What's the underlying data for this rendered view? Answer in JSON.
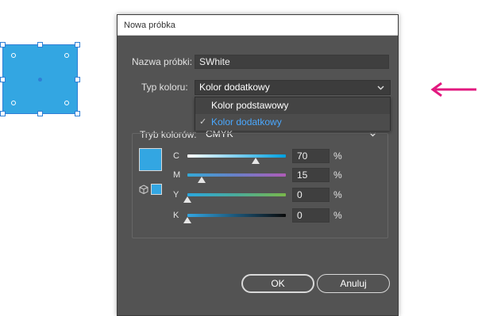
{
  "dialog": {
    "title": "Nowa próbka",
    "swatch_name_label": "Nazwa próbki:",
    "swatch_name_value": "SWhite",
    "color_type_label": "Typ koloru:",
    "color_type_value": "Kolor dodatkowy",
    "color_mode_label": "Tryb kolorów:",
    "color_mode_value": "CMYK",
    "ok_label": "OK",
    "cancel_label": "Anuluj"
  },
  "color_type_menu": {
    "options": [
      {
        "label": "Kolor podstawowy",
        "selected": false
      },
      {
        "label": "Kolor dodatkowy",
        "selected": true
      }
    ],
    "check": "✓"
  },
  "cmyk": {
    "unit": "%",
    "channels": [
      {
        "letter": "C",
        "value": "70"
      },
      {
        "letter": "M",
        "value": "15"
      },
      {
        "letter": "Y",
        "value": "0"
      },
      {
        "letter": "K",
        "value": "0"
      }
    ]
  },
  "colors": {
    "swatch": "#33a6e2",
    "accent": "#e2187f",
    "selection": "#2f7fd6"
  },
  "icons": {
    "arrow": "arrow-left-icon",
    "cube": "cube-icon",
    "chevron": "chevron-down-icon",
    "check": "checkmark-icon"
  }
}
